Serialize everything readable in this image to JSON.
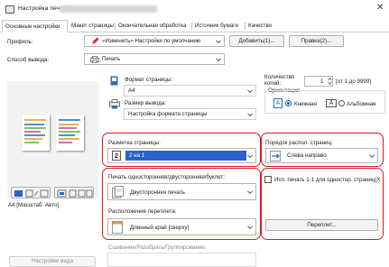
{
  "window": {
    "title": "Настройка печати:",
    "close_glyph": "✕"
  },
  "tabs": [
    {
      "label": "Основные настройки"
    },
    {
      "label": "Макет страницы"
    },
    {
      "label": "Окончательная обработка"
    },
    {
      "label": "Источник бумаги"
    },
    {
      "label": "Качество"
    }
  ],
  "profile": {
    "label": "Профиль:",
    "value": "«Изменить» Настройки по умолчанию",
    "add_button": "Добавить(1)...",
    "edit_button": "Правка(2)..."
  },
  "output_method": {
    "label": "Способ вывода:",
    "value": "Печать"
  },
  "page_size": {
    "label": "Формат страницы:",
    "value": "A4"
  },
  "output_size": {
    "label": "Размер вывода:",
    "value": "Настройка формата страницы"
  },
  "copies": {
    "label_line1": "Количество",
    "label_line2": "копий:",
    "value": "1",
    "range": "[от 1 до 9999]"
  },
  "orientation": {
    "label": "Ориентация",
    "portrait": "Книжная",
    "landscape": "Альбомная",
    "portrait_icon_letter": "A",
    "landscape_icon_letter": "A"
  },
  "page_layout": {
    "label": "Разметка страницы:",
    "value": "2 на 1",
    "icon_number": "2"
  },
  "page_order": {
    "label": "Порядок распол. страниц:",
    "value": "Слева направо"
  },
  "print_mode": {
    "label": "Печать односторонняя/двусторонняя/буклет:",
    "value": "Двусторонняя печать"
  },
  "one_sided_checkbox": {
    "label": "Исп. печать 1-1 для одностор. страниц(X",
    "checked": false
  },
  "binding_location": {
    "label": "Расположение переплета:",
    "value": "Длинный край [сверху]",
    "button": "Переплет..."
  },
  "collate": {
    "label": "Сшивание/Разобрать/Группирование:"
  },
  "preview": {
    "caption": "A4 [Масштаб: Авто]",
    "settings_view_label": "Настройки вида"
  },
  "colors": {
    "highlight_red": "#d81c22",
    "selection_blue": "#2b63c6",
    "accent_blue": "#1a5fb4"
  }
}
